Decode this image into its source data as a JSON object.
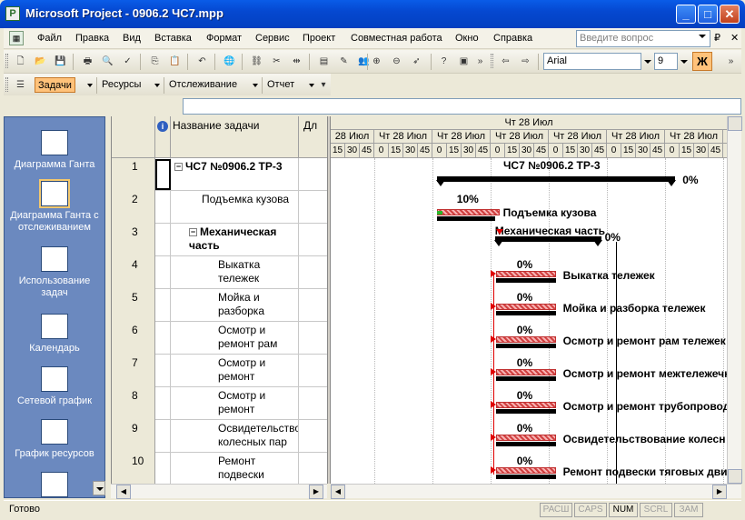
{
  "window": {
    "title": "Microsoft Project - 0906.2 ЧС7.mpp",
    "minimize": "_",
    "maximize": "□",
    "close": "✕"
  },
  "menu": {
    "items": [
      "Файл",
      "Правка",
      "Вид",
      "Вставка",
      "Формат",
      "Сервис",
      "Проект",
      "Совместная работа",
      "Окно",
      "Справка"
    ],
    "help_placeholder": "Введите вопрос",
    "mdi_restore": "₽",
    "mdi_close": "✕"
  },
  "toolbar": {
    "font": "Arial",
    "size": "9",
    "bold_label": "Ж"
  },
  "toolbar2": {
    "tasks": "Задачи",
    "resources": "Ресурсы",
    "tracking": "Отслеживание",
    "report": "Отчет"
  },
  "viewbar": {
    "items": [
      {
        "label": "Диаграмма Ганта",
        "icon": "gantt-chart-icon"
      },
      {
        "label": "Диаграмма Ганта с отслеживанием",
        "icon": "tracking-gantt-icon",
        "selected": true
      },
      {
        "label": "Использование задач",
        "icon": "task-usage-icon"
      },
      {
        "label": "Календарь",
        "icon": "calendar-icon"
      },
      {
        "label": "Сетевой график",
        "icon": "network-diagram-icon"
      },
      {
        "label": "График ресурсов",
        "icon": "resource-graph-icon"
      }
    ]
  },
  "grid": {
    "name_header": "Название задачи",
    "dur_header": "Дл",
    "rows": [
      {
        "id": "1",
        "name": "ЧС7 №0906.2 ТР-3",
        "level": 0,
        "summary": true
      },
      {
        "id": "2",
        "name": "Подъемка кузова",
        "level": 1,
        "summary": false
      },
      {
        "id": "3",
        "name": "Механическая часть",
        "level": 1,
        "summary": true
      },
      {
        "id": "4",
        "name": "Выкатка тележек",
        "level": 2,
        "summary": false
      },
      {
        "id": "5",
        "name": "Мойка и разборка",
        "level": 2,
        "summary": false
      },
      {
        "id": "6",
        "name": "Осмотр и ремонт рам",
        "level": 2,
        "summary": false
      },
      {
        "id": "7",
        "name": "Осмотр и ремонт",
        "level": 2,
        "summary": false
      },
      {
        "id": "8",
        "name": "Осмотр и ремонт",
        "level": 2,
        "summary": false
      },
      {
        "id": "9",
        "name": "Освидетельство колесных пар",
        "level": 2,
        "summary": false
      },
      {
        "id": "10",
        "name": "Ремонт подвески",
        "level": 2,
        "summary": false
      }
    ]
  },
  "gantt": {
    "top_tier": "Чт 28 Июл",
    "mid_tier": [
      "28 Июл",
      "Чт 28 Июл",
      "Чт 28 Июл",
      "Чт 28 Июл",
      "Чт 28 Июл",
      "Чт 28 Июл",
      "Чт 28 Июл",
      "Чт"
    ],
    "minutes": [
      "15",
      "30",
      "45",
      "0",
      "15",
      "30",
      "45",
      "0",
      "15",
      "30",
      "45",
      "0",
      "15",
      "30",
      "45",
      "0",
      "15",
      "30",
      "45",
      "0",
      "15",
      "30",
      "45",
      "0",
      "15",
      "30",
      "45",
      "0",
      "15",
      "30",
      "45"
    ],
    "bars": [
      {
        "label": "ЧС7 №0906.2 ТР-3",
        "pct": "0%"
      },
      {
        "label": "Подъемка кузова",
        "pct": "10%"
      },
      {
        "label": "Механическая часть",
        "pct": "0%"
      },
      {
        "label": "Выкатка тележек",
        "pct": "0%"
      },
      {
        "label": "Мойка и разборка тележек",
        "pct": "0%"
      },
      {
        "label": "Осмотр и ремонт рам тележек",
        "pct": "0%"
      },
      {
        "label": "Осмотр и ремонт межтележечн",
        "pct": "0%"
      },
      {
        "label": "Осмотр и ремонт трубопроводо",
        "pct": "0%"
      },
      {
        "label": "Освидетельствование колесн",
        "pct": "0%"
      },
      {
        "label": "Ремонт подвески тяговых двиг",
        "pct": "0%"
      }
    ]
  },
  "status": {
    "ready": "Готово",
    "indicators": [
      {
        "label": "РАСШ",
        "on": false
      },
      {
        "label": "CAPS",
        "on": false
      },
      {
        "label": "NUM",
        "on": true
      },
      {
        "label": "SCRL",
        "on": false
      },
      {
        "label": "ЗАМ",
        "on": false
      }
    ]
  }
}
